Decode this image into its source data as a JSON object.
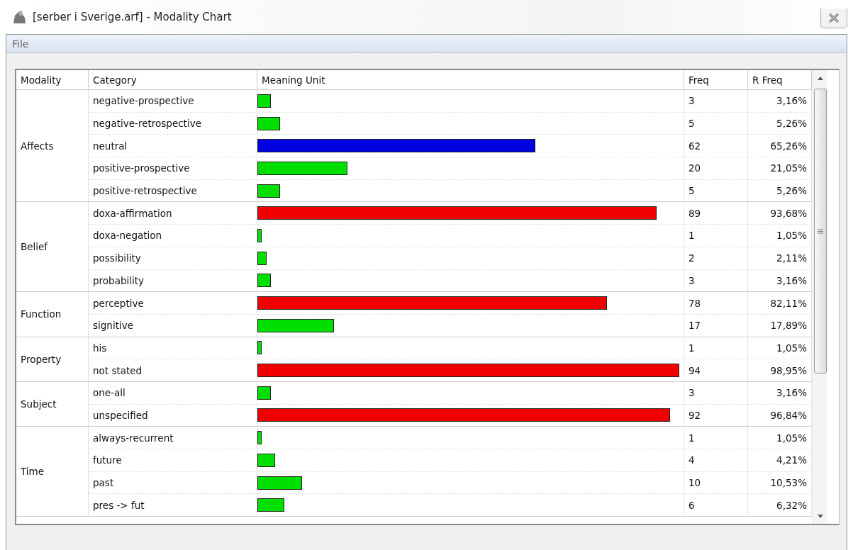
{
  "window": {
    "title": "[serber i Sverige.arf] - Modality Chart"
  },
  "menu": [
    {
      "label": "File"
    }
  ],
  "table": {
    "columns": [
      "Modality",
      "Category",
      "Meaning Unit",
      "Freq",
      "R Freq"
    ],
    "groups": [
      {
        "modality": "Affects",
        "rows": [
          {
            "category": "negative-prospective",
            "level": 0.0316,
            "color": "#00e000",
            "freq": "3",
            "rfreq": "3,16%"
          },
          {
            "category": "negative-retrospective",
            "level": 0.0526,
            "color": "#00e000",
            "freq": "5",
            "rfreq": "5,26%"
          },
          {
            "category": "neutral",
            "level": 0.6526,
            "color": "#0000e0",
            "freq": "62",
            "rfreq": "65,26%"
          },
          {
            "category": "positive-prospective",
            "level": 0.2105,
            "color": "#00e000",
            "freq": "20",
            "rfreq": "21,05%"
          },
          {
            "category": "positive-retrospective",
            "level": 0.0526,
            "color": "#00e000",
            "freq": "5",
            "rfreq": "5,26%"
          }
        ]
      },
      {
        "modality": "Belief",
        "rows": [
          {
            "category": "doxa-affirmation",
            "level": 0.9368,
            "color": "#f00000",
            "freq": "89",
            "rfreq": "93,68%"
          },
          {
            "category": "doxa-negation",
            "level": 0.0105,
            "color": "#00e000",
            "freq": "1",
            "rfreq": "1,05%"
          },
          {
            "category": "possibility",
            "level": 0.0211,
            "color": "#00e000",
            "freq": "2",
            "rfreq": "2,11%"
          },
          {
            "category": "probability",
            "level": 0.0316,
            "color": "#00e000",
            "freq": "3",
            "rfreq": "3,16%"
          }
        ]
      },
      {
        "modality": "Function",
        "rows": [
          {
            "category": "perceptive",
            "level": 0.8211,
            "color": "#f00000",
            "freq": "78",
            "rfreq": "82,11%"
          },
          {
            "category": "signitive",
            "level": 0.1789,
            "color": "#00e000",
            "freq": "17",
            "rfreq": "17,89%"
          }
        ]
      },
      {
        "modality": "Property",
        "rows": [
          {
            "category": "his",
            "level": 0.0105,
            "color": "#00e000",
            "freq": "1",
            "rfreq": "1,05%"
          },
          {
            "category": "not stated",
            "level": 0.9895,
            "color": "#f00000",
            "freq": "94",
            "rfreq": "98,95%"
          }
        ]
      },
      {
        "modality": "Subject",
        "rows": [
          {
            "category": "one-all",
            "level": 0.0316,
            "color": "#00e000",
            "freq": "3",
            "rfreq": "3,16%"
          },
          {
            "category": "unspecified",
            "level": 0.9684,
            "color": "#f00000",
            "freq": "92",
            "rfreq": "96,84%"
          }
        ]
      },
      {
        "modality": "Time",
        "rows": [
          {
            "category": "always-recurrent",
            "level": 0.0105,
            "color": "#00e000",
            "freq": "1",
            "rfreq": "1,05%"
          },
          {
            "category": "future",
            "level": 0.0421,
            "color": "#00e000",
            "freq": "4",
            "rfreq": "4,21%"
          },
          {
            "category": "past",
            "level": 0.1053,
            "color": "#00e000",
            "freq": "10",
            "rfreq": "10,53%"
          },
          {
            "category": "pres -> fut",
            "level": 0.0632,
            "color": "#00e000",
            "freq": "6",
            "rfreq": "6,32%"
          }
        ]
      }
    ]
  }
}
